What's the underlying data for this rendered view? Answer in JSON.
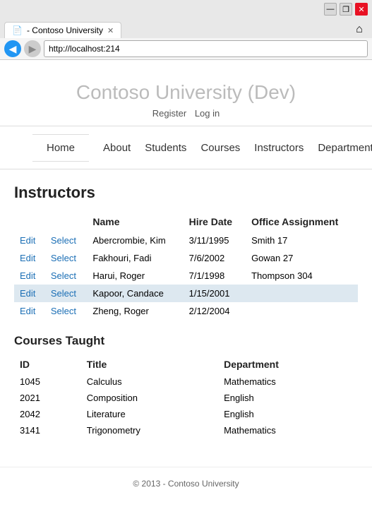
{
  "browser": {
    "url": "http://localhost:214",
    "tab_title": "- Contoso University",
    "back_icon": "◀",
    "fwd_icon": "▶",
    "home_icon": "⌂",
    "win_minimize": "—",
    "win_restore": "❐",
    "win_close": "✕"
  },
  "site": {
    "title": "Contoso University (Dev)",
    "auth": {
      "register": "Register",
      "login": "Log in"
    },
    "nav": [
      "Home",
      "About",
      "Students",
      "Courses",
      "Instructors",
      "Departments"
    ]
  },
  "instructors_page": {
    "heading": "Instructors",
    "table_headers": [
      "",
      "",
      "Name",
      "Hire Date",
      "Office Assignment"
    ],
    "rows": [
      {
        "edit": "Edit",
        "select": "Select",
        "name": "Abercrombie, Kim",
        "hire_date": "3/11/1995",
        "office": "Smith 17",
        "selected": false
      },
      {
        "edit": "Edit",
        "select": "Select",
        "name": "Fakhouri, Fadi",
        "hire_date": "7/6/2002",
        "office": "Gowan 27",
        "selected": false
      },
      {
        "edit": "Edit",
        "select": "Select",
        "name": "Harui, Roger",
        "hire_date": "7/1/1998",
        "office": "Thompson 304",
        "selected": false
      },
      {
        "edit": "Edit",
        "select": "Select",
        "name": "Kapoor, Candace",
        "hire_date": "1/15/2001",
        "office": "",
        "selected": true
      },
      {
        "edit": "Edit",
        "select": "Select",
        "name": "Zheng, Roger",
        "hire_date": "2/12/2004",
        "office": "",
        "selected": false
      }
    ],
    "courses_heading": "Courses Taught",
    "courses_headers": [
      "ID",
      "Title",
      "Department"
    ],
    "courses": [
      {
        "id": "1045",
        "title": "Calculus",
        "department": "Mathematics"
      },
      {
        "id": "2021",
        "title": "Composition",
        "department": "English"
      },
      {
        "id": "2042",
        "title": "Literature",
        "department": "English"
      },
      {
        "id": "3141",
        "title": "Trigonometry",
        "department": "Mathematics"
      }
    ]
  },
  "footer": {
    "text": "© 2013 - Contoso University"
  }
}
